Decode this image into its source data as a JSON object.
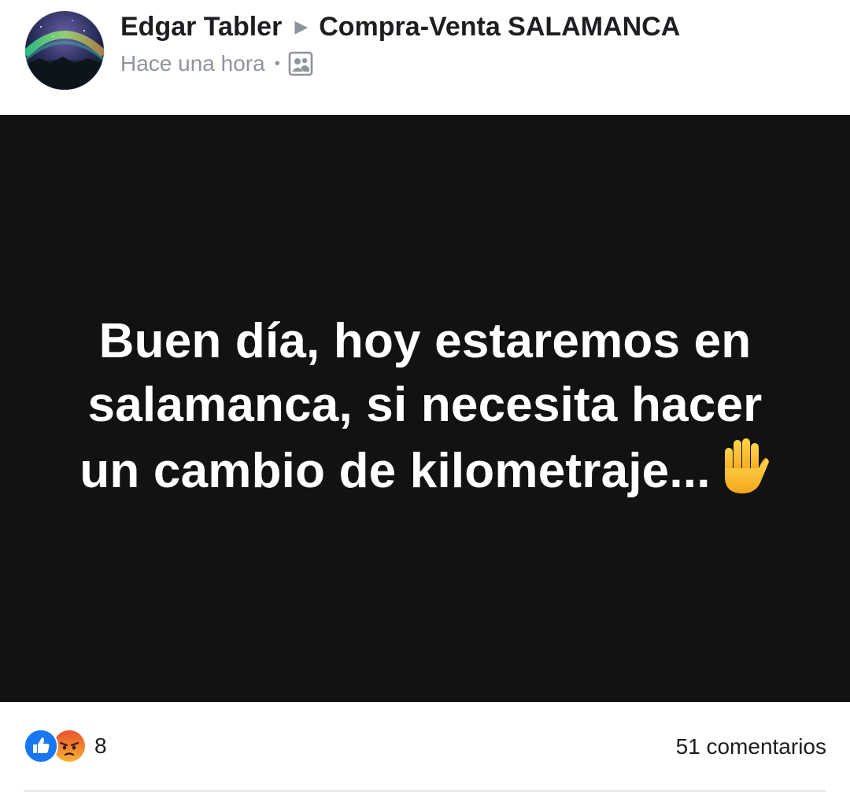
{
  "post": {
    "author": "Edgar Tabler",
    "group": "Compra-Venta SALAMANCA",
    "timestamp": "Hace una hora",
    "separator": "•",
    "audience_icon": "group-audience-icon",
    "text": "Buen día, hoy estaremos en salamanca, si necesita hacer un cambio de kilometraje...",
    "emoji": "raised-hand-emoji"
  },
  "footer": {
    "reactions": [
      "like",
      "angry"
    ],
    "reaction_count": "8",
    "comments": "51 comentarios"
  },
  "colors": {
    "card_background": "#121212",
    "like_blue": "#1877f2",
    "angry_orange": "#f08a24",
    "meta_gray": "#90949c"
  }
}
